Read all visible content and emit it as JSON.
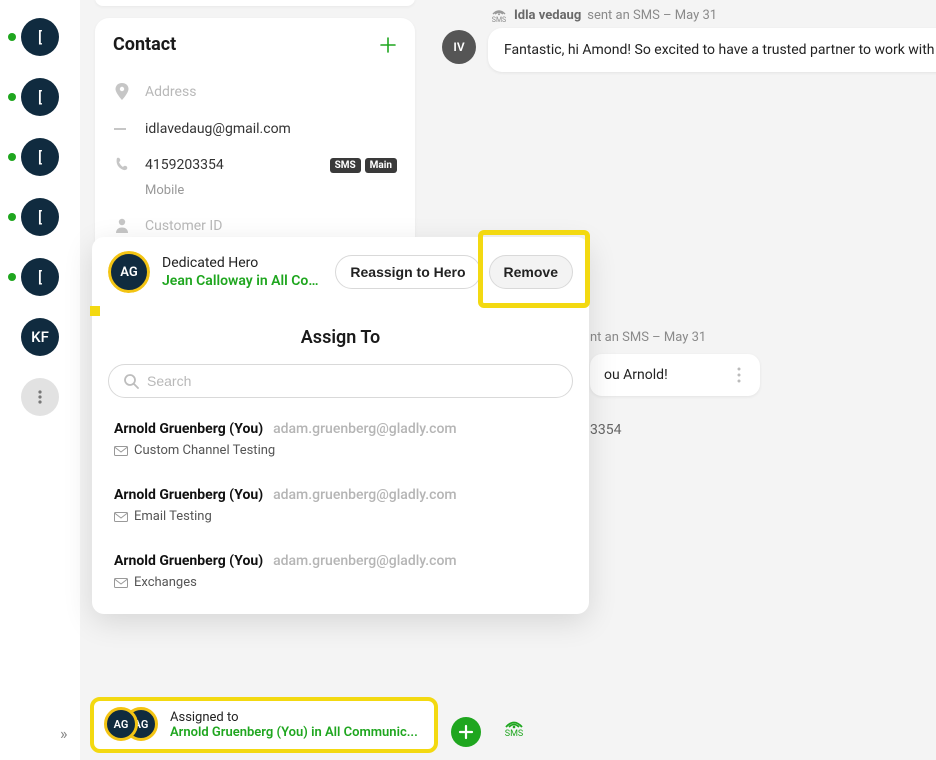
{
  "rail": {
    "items": [
      {
        "initials": "[",
        "dot": true
      },
      {
        "initials": "[",
        "dot": true
      },
      {
        "initials": "[",
        "dot": true
      },
      {
        "initials": "[",
        "dot": true
      },
      {
        "initials": "[",
        "dot": true
      },
      {
        "initials": "KF",
        "dot": false
      }
    ]
  },
  "contact": {
    "title": "Contact",
    "address_placeholder": "Address",
    "email": "idlavedaug@gmail.com",
    "phone": "4159203354",
    "phone_type": "Mobile",
    "badge_sms": "SMS",
    "badge_main": "Main",
    "customer_id_placeholder": "Customer ID"
  },
  "hero": {
    "avatar": "AG",
    "title": "Dedicated Hero",
    "subtitle": "Jean Calloway in All Commu...",
    "reassign_label": "Reassign to Hero",
    "remove_label": "Remove"
  },
  "assign": {
    "title": "Assign To",
    "search_placeholder": "Search",
    "items": [
      {
        "name": "Arnold Gruenberg (You)",
        "email": "adam.gruenberg@gladly.com",
        "channel": "Custom Channel Testing"
      },
      {
        "name": "Arnold Gruenberg (You)",
        "email": "adam.gruenberg@gladly.com",
        "channel": "Email Testing"
      },
      {
        "name": "Arnold Gruenberg (You)",
        "email": "adam.gruenberg@gladly.com",
        "channel": "Exchanges"
      }
    ]
  },
  "conversation": {
    "meta1_name": "Idla vedaug",
    "meta1_rest": "sent an SMS – May 31",
    "avatar1": "IV",
    "bubble1": "Fantastic, hi Amond! So excited to have a trusted partner to work with",
    "meta2_rest": "nt an SMS – May 31",
    "bubble2": "ou Arnold!",
    "phone_partial": "3354",
    "sms_label": "SMS"
  },
  "assigned": {
    "avatar1": "AG",
    "avatar2": "AG",
    "title": "Assigned to",
    "subtitle": "Arnold Gruenberg (You) in All Communic..."
  },
  "controls": {
    "collapse": "»",
    "sms_label": "SMS"
  }
}
